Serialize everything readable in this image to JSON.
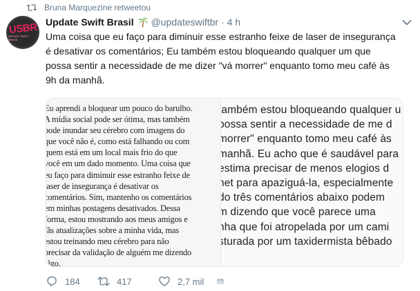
{
  "retweet_context": {
    "text": "Bruna Marquezine retweetou"
  },
  "author": {
    "display_name": "Update Swift Brasil",
    "handle": "@updateswiftbr",
    "time": "4 h",
    "avatar": {
      "logo_text": "USBR",
      "sub_text": "UPDATE SWIFT BRASIL"
    }
  },
  "tweet": {
    "text": "Uma coisa que eu faço para diminuir esse estranho feixe de laser de insegurança\né desativar os comentários; Eu também estou bloqueando qualquer um que\npossa sentir a necessidade de me dizer \"vá morrer\" enquanto tomo meu café às\n9h da manhã."
  },
  "media": {
    "left_image_text": "Eu aprendi a bloquear um pouco do barulho.\nA mídia social pode ser ótima, mas também\npode inundar seu cérebro com imagens do\nque você não é, como está falhando ou com\nquem está em um local mais frio do que\nvocê em um dado momento. Uma coisa que\neu faço para diminuir esse estranho feixe de\nlaser de insegurança é desativar os\ncomentários. Sim, mantenho os comentários\nem minhas postagens desativados. Dessa\nforma, estou mostrando aos meus amigos e\nfãs atualizações sobre a minha vida, mas\nestou treinando meu cérebro para não\nprecisar da validação de alguém me dizendo\nalgo.",
    "right_image_text": "também estou bloqueando qualquer u\npossa sentir a necessidade de me d\nmorrer\" enquanto tomo meu café às\nmanhã. Eu acho que é saudável para\nestima precisar de menos elogios d\nnet para apaziguá-la, especialmente\ndo três comentários abaixo podem\nm dizendo que você parece uma\nnha que foi atropelada por um cami\nsturada por um taxidermista bêbado"
  },
  "actions": {
    "reply_count": "184",
    "retweet_count": "417",
    "like_count": "2,7 mil"
  },
  "colors": {
    "text_primary": "#14171a",
    "text_secondary": "#657786",
    "avatar_accent": "#e0245e",
    "border": "#e1e8ed"
  },
  "icons": {
    "retweet_context": "retweet-icon",
    "emoji": "palm-tree-icon",
    "menu": "chevron-down-icon",
    "reply": "reply-icon",
    "retweet": "retweet-icon",
    "like": "heart-icon",
    "message": "envelope-icon"
  }
}
